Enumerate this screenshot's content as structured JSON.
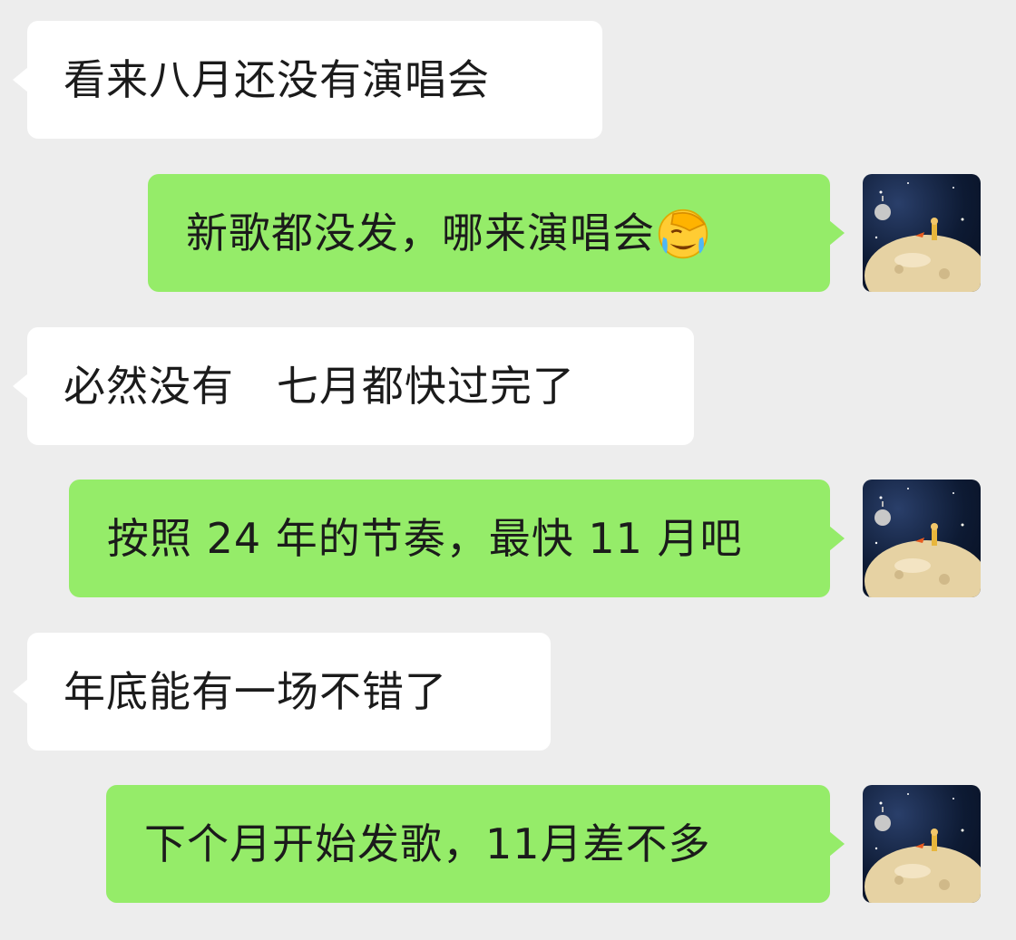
{
  "chat": {
    "messages": [
      {
        "side": "left",
        "text": "看来八月还没有演唱会"
      },
      {
        "side": "right",
        "text": "新歌都没发，哪来演唱会",
        "emoji": "face-palm-crying-emoji"
      },
      {
        "side": "left",
        "text": "必然没有   七月都快过完了"
      },
      {
        "side": "right",
        "text": "按照 24 年的节奏，最快 11 月吧"
      },
      {
        "side": "left",
        "text": "年底能有一场不错了"
      },
      {
        "side": "right",
        "text": "下个月开始发歌，11月差不多"
      }
    ]
  },
  "avatar": {
    "description_icon": "little-prince-planet-avatar"
  },
  "colors": {
    "background": "#ededed",
    "incoming_bubble": "#ffffff",
    "outgoing_bubble": "#95ec69"
  }
}
